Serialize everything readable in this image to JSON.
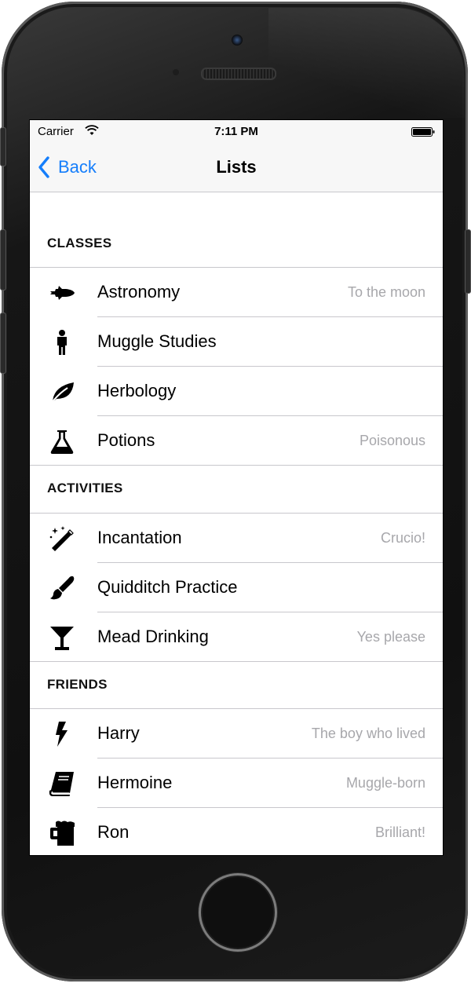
{
  "status_bar": {
    "carrier": "Carrier",
    "time": "7:11 PM"
  },
  "nav": {
    "back_label": "Back",
    "title": "Lists"
  },
  "sections": [
    {
      "header": "CLASSES",
      "rows": [
        {
          "icon": "space-shuttle-icon",
          "title": "Astronomy",
          "detail": "To the moon"
        },
        {
          "icon": "person-icon",
          "title": "Muggle Studies",
          "detail": ""
        },
        {
          "icon": "leaf-icon",
          "title": "Herbology",
          "detail": ""
        },
        {
          "icon": "flask-icon",
          "title": "Potions",
          "detail": "Poisonous"
        }
      ]
    },
    {
      "header": "ACTIVITIES",
      "rows": [
        {
          "icon": "magic-wand-icon",
          "title": "Incantation",
          "detail": "Crucio!"
        },
        {
          "icon": "paintbrush-icon",
          "title": "Quidditch Practice",
          "detail": ""
        },
        {
          "icon": "cocktail-glass-icon",
          "title": "Mead Drinking",
          "detail": "Yes please"
        }
      ]
    },
    {
      "header": "FRIENDS",
      "rows": [
        {
          "icon": "lightning-bolt-icon",
          "title": "Harry",
          "detail": "The boy who lived"
        },
        {
          "icon": "book-icon",
          "title": "Hermoine",
          "detail": "Muggle-born"
        },
        {
          "icon": "beer-mug-icon",
          "title": "Ron",
          "detail": "Brilliant!"
        }
      ]
    }
  ],
  "colors": {
    "accent": "#157efb",
    "detail_text": "#a7a7ab",
    "separator": "#c8c7cc"
  }
}
